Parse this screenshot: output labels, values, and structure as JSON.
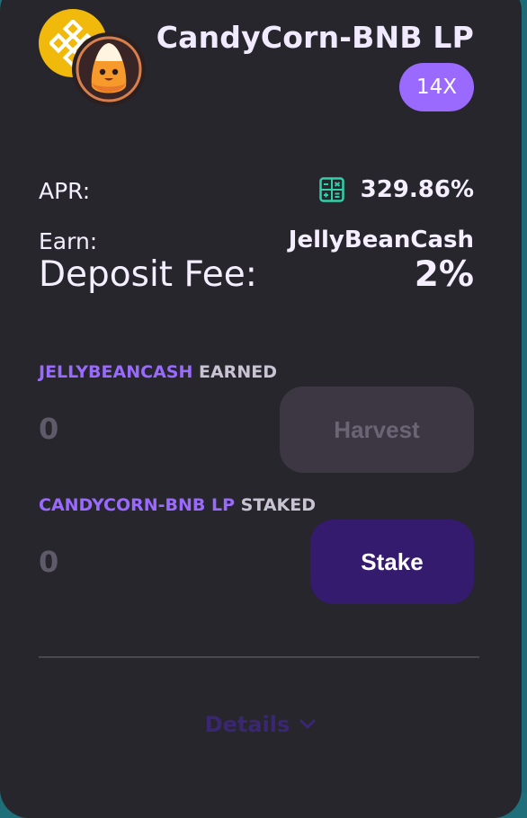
{
  "farm": {
    "pair_name": "CandyCorn-BNB LP",
    "multiplier": "14X",
    "tokens": {
      "primary_icon": "bnb-logo",
      "secondary_icon": "candycorn-mascot"
    }
  },
  "stats": {
    "apr_label": "APR:",
    "apr_value": "329.86%",
    "earn_label": "Earn:",
    "earn_value": "JellyBeanCash",
    "fee_label": "Deposit Fee:",
    "fee_value": "2%"
  },
  "earned": {
    "token": "JELLYBEANCASH",
    "suffix": "EARNED",
    "amount": "0",
    "harvest_label": "Harvest"
  },
  "staked": {
    "token": "CANDYCORN-BNB LP",
    "suffix": "STAKED",
    "amount": "0",
    "stake_label": "Stake"
  },
  "footer": {
    "details_label": "Details"
  },
  "colors": {
    "card_bg": "#27262c",
    "accent": "#9a6aff",
    "stake_button": "#341b6e",
    "bnb_gold": "#f0b90b",
    "calc_icon": "#31d0aa"
  }
}
